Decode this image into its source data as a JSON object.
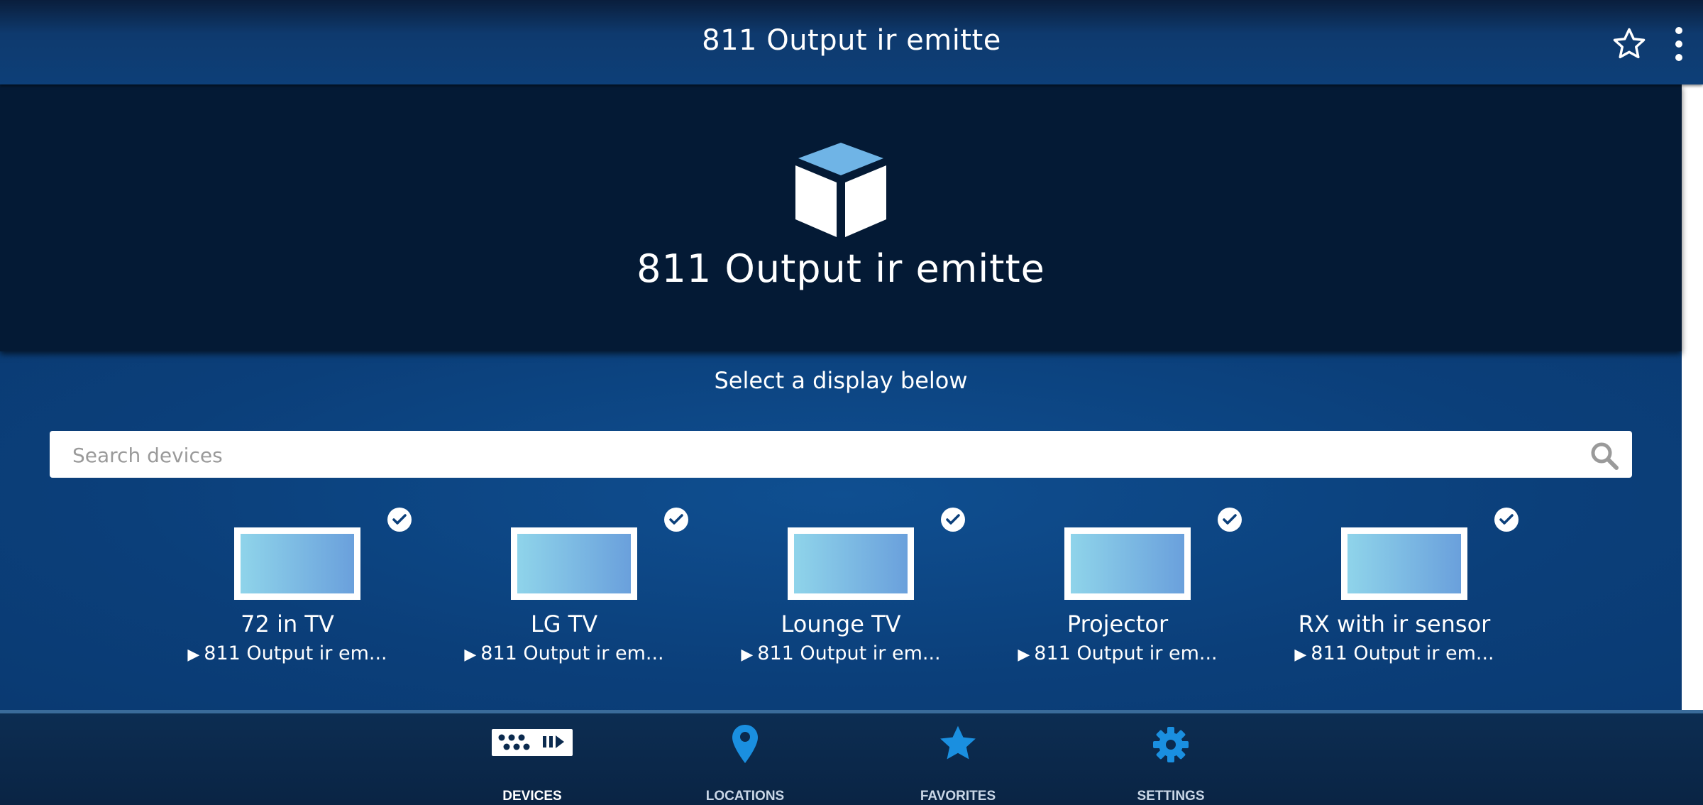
{
  "header": {
    "title": "811 Output ir emitte",
    "favorite_icon": "star-outline-icon",
    "more_icon": "more-vertical-icon"
  },
  "hero": {
    "icon": "cube-icon",
    "title": "811 Output ir emitte"
  },
  "main": {
    "subtitle": "Select a display below",
    "search": {
      "placeholder": "Search devices",
      "value": ""
    },
    "devices": [
      {
        "name": "72 in TV",
        "source": "811 Output ir em...",
        "checked": true
      },
      {
        "name": "LG TV",
        "source": "811 Output ir em...",
        "checked": true
      },
      {
        "name": "Lounge TV",
        "source": "811 Output ir em...",
        "checked": true
      },
      {
        "name": "Projector",
        "source": "811 Output ir em...",
        "checked": true
      },
      {
        "name": "RX with ir sensor",
        "source": "811 Output ir em...",
        "checked": true
      }
    ]
  },
  "bottom_nav": {
    "items": [
      {
        "label": "DEVICES",
        "icon": "devices-icon",
        "active": true
      },
      {
        "label": "LOCATIONS",
        "icon": "location-pin-icon",
        "active": false
      },
      {
        "label": "FAVORITES",
        "icon": "star-icon",
        "active": false
      },
      {
        "label": "SETTINGS",
        "icon": "gear-icon",
        "active": false
      }
    ]
  },
  "colors": {
    "accent": "#1a8fe0",
    "active_nav": "#ffffff",
    "inactive_nav_label": "#c9d6e6"
  }
}
